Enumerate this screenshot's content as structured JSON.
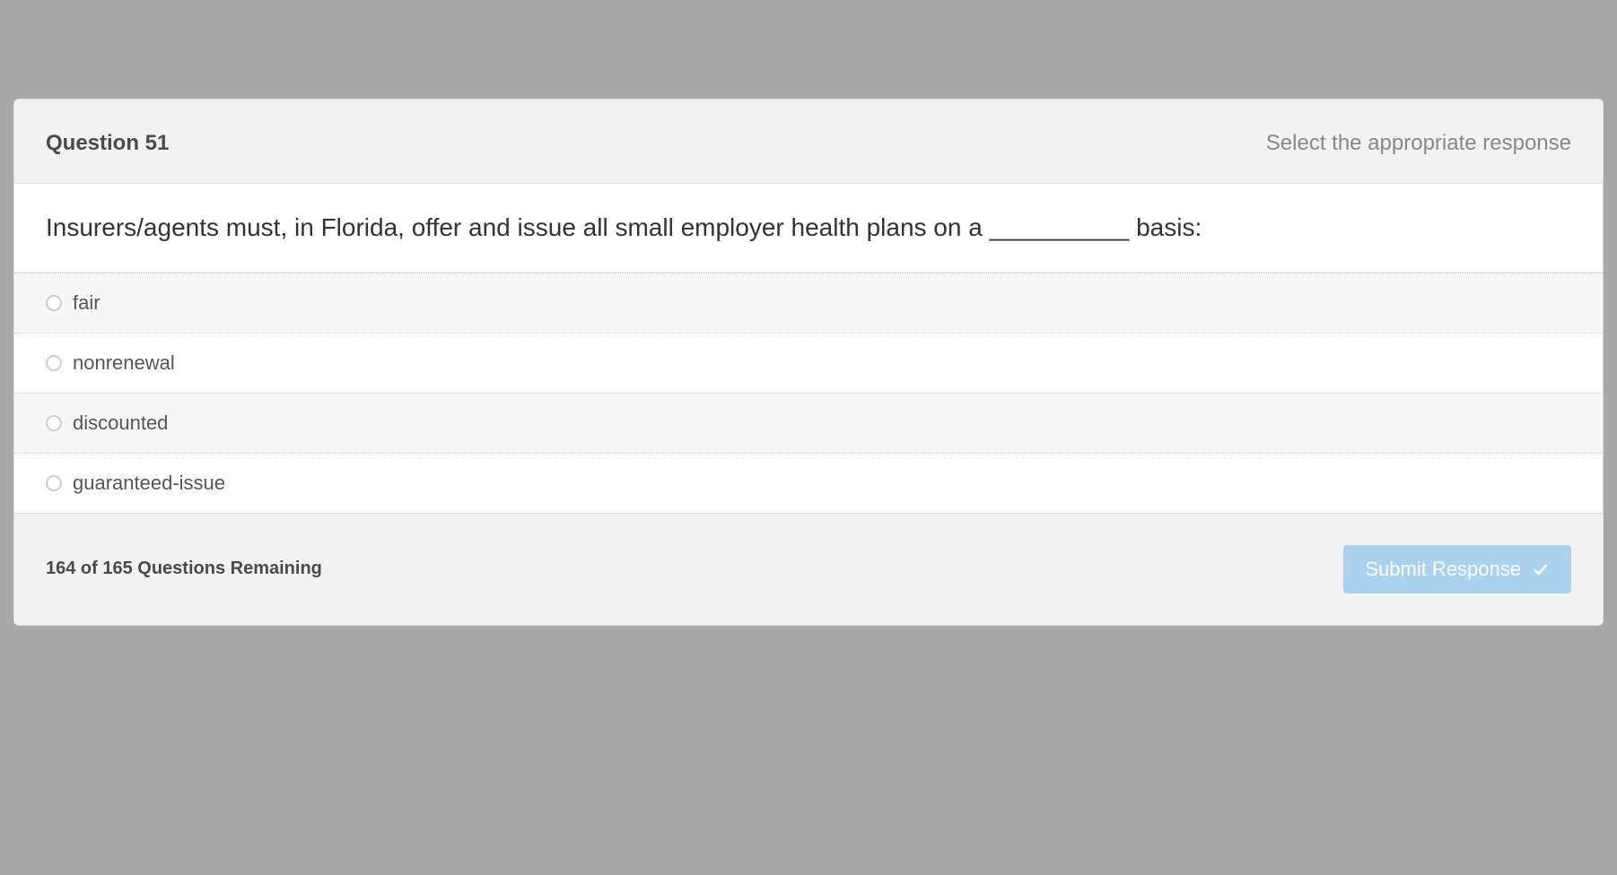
{
  "header": {
    "question_label": "Question 51",
    "instruction": "Select the appropriate response"
  },
  "question": {
    "text": "Insurers/agents must, in Florida, offer and issue all small employer health plans on a __________ basis:"
  },
  "options": [
    {
      "label": "fair"
    },
    {
      "label": "nonrenewal"
    },
    {
      "label": "discounted"
    },
    {
      "label": "guaranteed-issue"
    }
  ],
  "footer": {
    "remaining": "164 of 165 Questions Remaining",
    "submit_label": "Submit Response"
  }
}
